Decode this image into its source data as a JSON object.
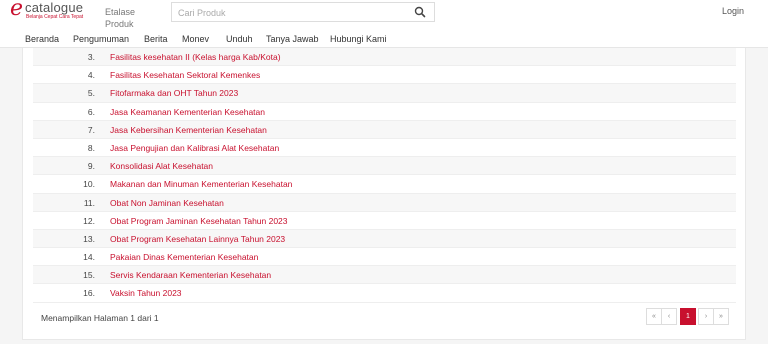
{
  "header": {
    "logo_e": "e",
    "logo_text": "catalogue",
    "logo_tagline": "Belanja Cepat Cara Tepat",
    "etalase_label": "Etalase Produk",
    "search_placeholder": "Cari Produk",
    "login_label": "Login"
  },
  "nav": {
    "items": [
      "Beranda",
      "Pengumuman",
      "Berita",
      "Monev",
      "Unduh",
      "Tanya Jawab",
      "Hubungi Kami"
    ]
  },
  "table": {
    "rows": [
      {
        "num": "3.",
        "label": "Fasilitas kesehatan II (Kelas harga Kab/Kota)"
      },
      {
        "num": "4.",
        "label": "Fasilitas Kesehatan Sektoral Kemenkes"
      },
      {
        "num": "5.",
        "label": "Fitofarmaka dan OHT Tahun 2023"
      },
      {
        "num": "6.",
        "label": "Jasa Keamanan Kementerian Kesehatan"
      },
      {
        "num": "7.",
        "label": "Jasa Kebersihan Kementerian Kesehatan"
      },
      {
        "num": "8.",
        "label": "Jasa Pengujian dan Kalibrasi Alat Kesehatan"
      },
      {
        "num": "9.",
        "label": "Konsolidasi Alat Kesehatan"
      },
      {
        "num": "10.",
        "label": "Makanan dan Minuman Kementerian Kesehatan"
      },
      {
        "num": "11.",
        "label": "Obat Non Jaminan Kesehatan"
      },
      {
        "num": "12.",
        "label": "Obat Program Jaminan Kesehatan Tahun 2023"
      },
      {
        "num": "13.",
        "label": "Obat Program Kesehatan Lainnya Tahun 2023"
      },
      {
        "num": "14.",
        "label": "Pakaian Dinas Kementerian Kesehatan"
      },
      {
        "num": "15.",
        "label": "Servis Kendaraan Kementerian Kesehatan"
      },
      {
        "num": "16.",
        "label": "Vaksin Tahun 2023"
      }
    ]
  },
  "footer": {
    "showing_text": "Menampilkan Halaman 1 dari 1",
    "pager": {
      "first": "«",
      "prev": "‹",
      "current": "1",
      "next": "›",
      "last": "»"
    }
  },
  "colors": {
    "accent": "#c8102e"
  }
}
